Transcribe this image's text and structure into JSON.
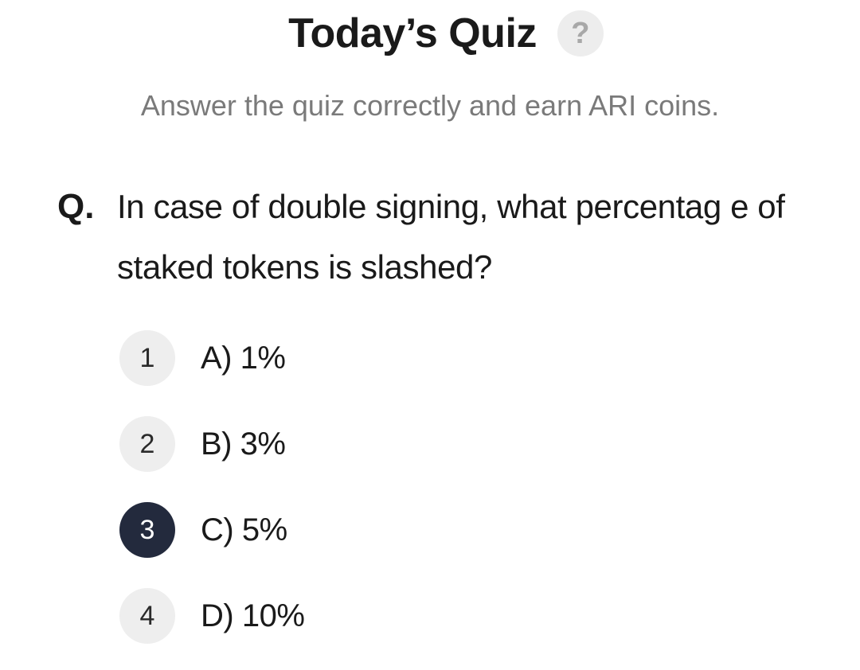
{
  "header": {
    "title": "Today’s Quiz",
    "help_icon": "question-mark-icon",
    "help_glyph": "?"
  },
  "subtitle": "Answer the quiz correctly and earn ARI coins.",
  "question": {
    "prefix": "Q.",
    "text": "In case of double signing, what percentag e of staked tokens is slashed?"
  },
  "options": [
    {
      "number": "1",
      "label": "A) 1%",
      "selected": false
    },
    {
      "number": "2",
      "label": "B) 3%",
      "selected": false
    },
    {
      "number": "3",
      "label": "C) 5%",
      "selected": true
    },
    {
      "number": "4",
      "label": "D) 10%",
      "selected": false
    }
  ],
  "colors": {
    "selected_bg": "#232a3d",
    "unselected_bg": "#eeeeee",
    "subtitle": "#7a7a7a"
  }
}
